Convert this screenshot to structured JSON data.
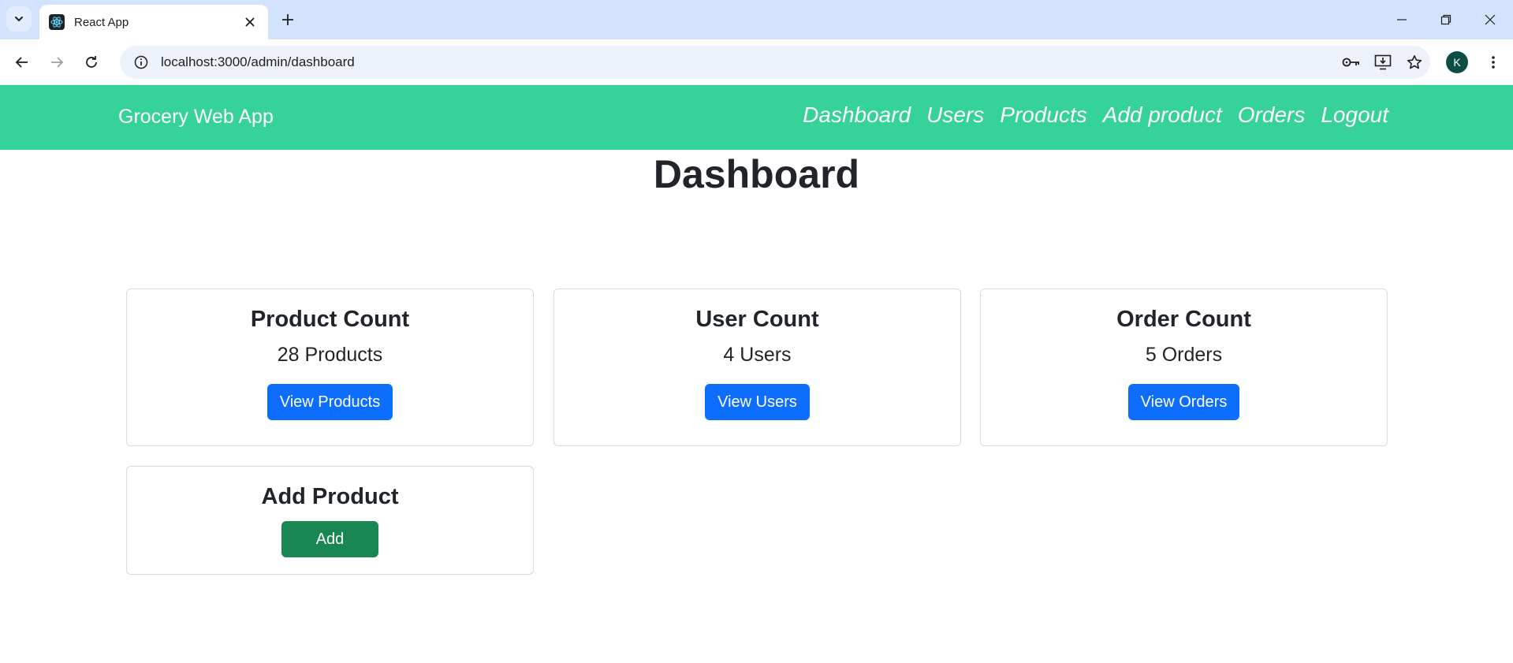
{
  "browser": {
    "tab_title": "React App",
    "url": "localhost:3000/admin/dashboard",
    "profile_initial": "K",
    "icons": [
      "tab-search-icon",
      "react-favicon-icon",
      "close-icon",
      "plus-icon",
      "minimize-icon",
      "restore-icon",
      "window-close-icon",
      "back-icon",
      "forward-icon",
      "reload-icon",
      "site-info-icon",
      "password-key-icon",
      "install-app-icon",
      "bookmark-star-icon",
      "kebab-menu-icon"
    ]
  },
  "navbar": {
    "brand": "Grocery Web App",
    "links": [
      "Dashboard",
      "Users",
      "Products",
      "Add product",
      "Orders",
      "Logout"
    ]
  },
  "page": {
    "title": "Dashboard"
  },
  "cards": {
    "products": {
      "title": "Product Count",
      "value": "28 Products",
      "button": "View Products"
    },
    "users": {
      "title": "User Count",
      "value": "4 Users",
      "button": "View Users"
    },
    "orders": {
      "title": "Order Count",
      "value": "5 Orders",
      "button": "View Orders"
    },
    "add": {
      "title": "Add Product",
      "button": "Add"
    }
  },
  "colors": {
    "navbar": "#35d399",
    "primary_button": "#0d6efd",
    "success_button": "#198754",
    "chrome_tabstrip": "#d3e3fd"
  }
}
